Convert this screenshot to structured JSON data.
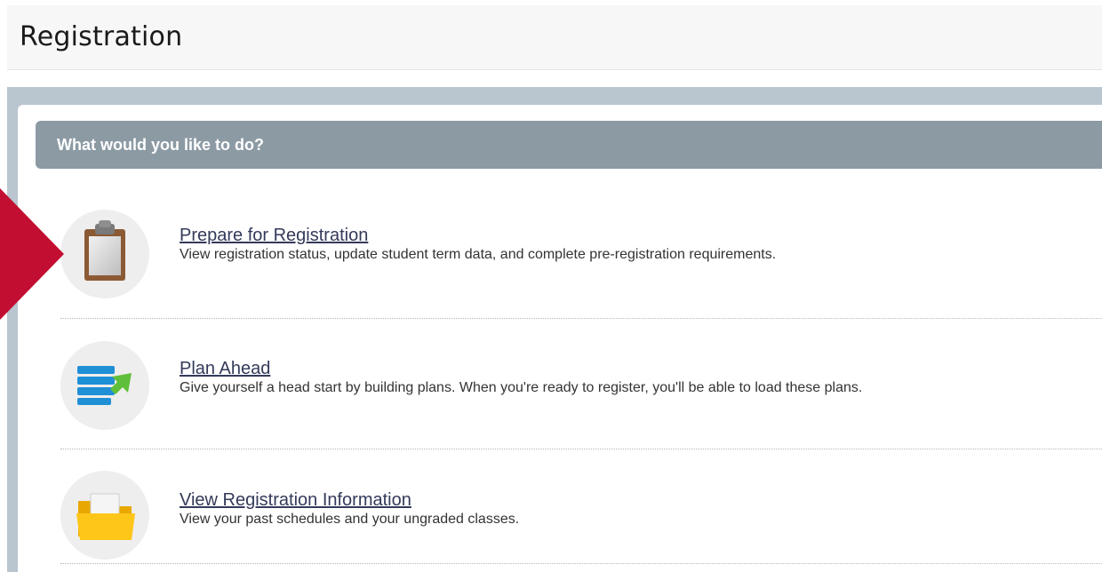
{
  "page": {
    "title": "Registration"
  },
  "section": {
    "title": "What would you like to do?"
  },
  "items": [
    {
      "label": "Prepare for Registration",
      "description": "View registration status, update student term data, and complete pre-registration requirements.",
      "icon": "clipboard-icon"
    },
    {
      "label": "Plan Ahead",
      "description": "Give yourself a head start by building plans. When you're ready to register, you'll be able to load these plans.",
      "icon": "plan-list-icon"
    },
    {
      "label": "View Registration Information",
      "description": "View your past schedules and your ungraded classes.",
      "icon": "folder-icon"
    }
  ],
  "colors": {
    "highlight_arrow": "#c20e31",
    "section_header": "#8c9aa4",
    "frame": "#b9c5cf"
  }
}
